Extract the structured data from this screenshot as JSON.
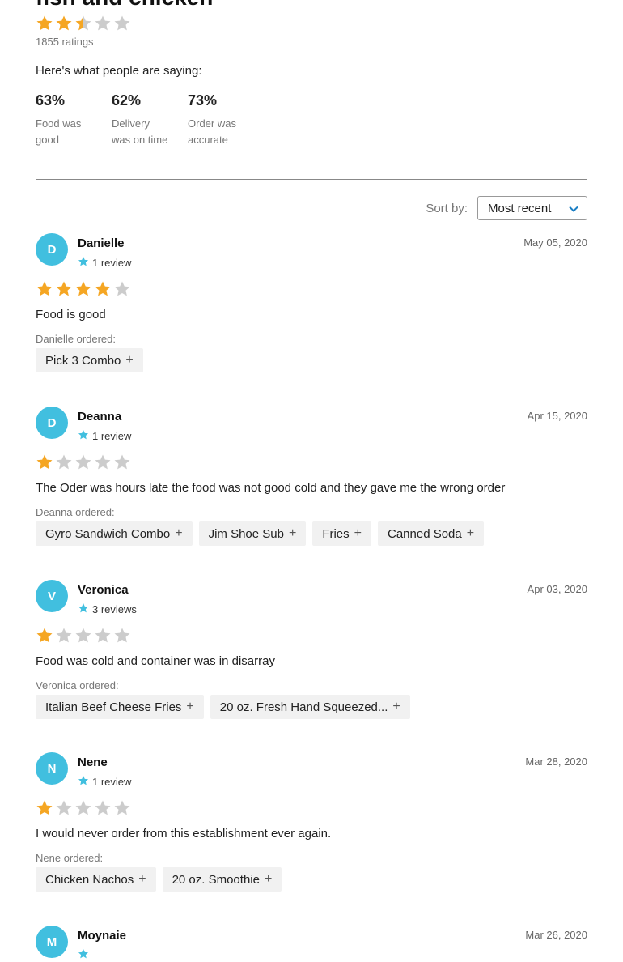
{
  "restaurant": {
    "title": "fish and chicken",
    "rating": 2.5,
    "ratings_count": "1855 ratings",
    "saying": "Here's what people are saying:"
  },
  "metrics": [
    {
      "pct": "63%",
      "label": "Food was good"
    },
    {
      "pct": "62%",
      "label": "Delivery was on time"
    },
    {
      "pct": "73%",
      "label": "Order was accurate"
    }
  ],
  "sort": {
    "label": "Sort by:",
    "selected": "Most recent"
  },
  "colors": {
    "star_filled": "#f5a623",
    "star_empty": "#cccccc",
    "accent": "#41bfdf",
    "chip_bg": "#f1f1f1"
  },
  "reviews": [
    {
      "initial": "D",
      "name": "Danielle",
      "count": "1 review",
      "date": "May 05, 2020",
      "rating": 4,
      "text": "Food is good",
      "ordered_label": "Danielle ordered:",
      "items": [
        "Pick 3 Combo"
      ]
    },
    {
      "initial": "D",
      "name": "Deanna",
      "count": "1 review",
      "date": "Apr 15, 2020",
      "rating": 1,
      "text": "The Oder was hours late the food was not good cold and they gave me the wrong order",
      "ordered_label": "Deanna ordered:",
      "items": [
        "Gyro Sandwich Combo",
        "Jim Shoe Sub",
        "Fries",
        "Canned Soda"
      ]
    },
    {
      "initial": "V",
      "name": "Veronica",
      "count": "3 reviews",
      "date": "Apr 03, 2020",
      "rating": 1,
      "text": "Food was cold and container was in disarray",
      "ordered_label": "Veronica ordered:",
      "items": [
        "Italian Beef Cheese Fries",
        "20 oz. Fresh Hand Squeezed..."
      ]
    },
    {
      "initial": "N",
      "name": "Nene",
      "count": "1 review",
      "date": "Mar 28, 2020",
      "rating": 1,
      "text": "I would never order from this establishment ever again.",
      "ordered_label": "Nene ordered:",
      "items": [
        "Chicken Nachos",
        "20 oz. Smoothie"
      ]
    },
    {
      "initial": "M",
      "name": "Moynaie",
      "count": "",
      "date": "Mar 26, 2020",
      "rating": null,
      "text": "",
      "ordered_label": "",
      "items": []
    }
  ]
}
